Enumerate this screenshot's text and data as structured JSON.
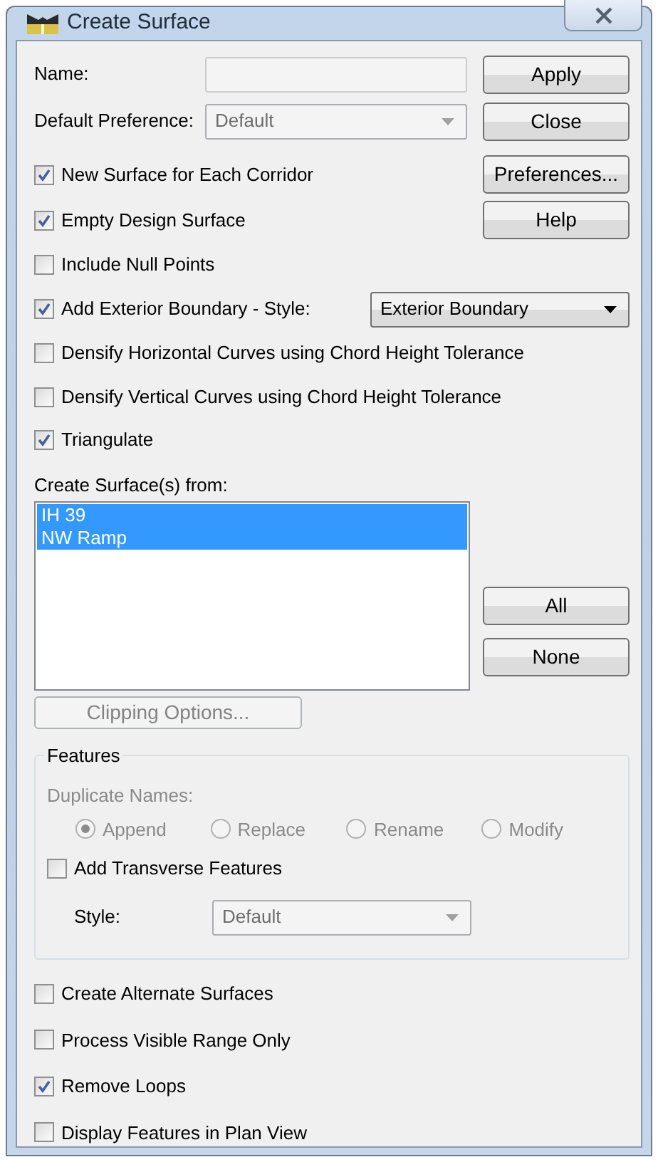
{
  "window": {
    "title": "Create Surface"
  },
  "name_field": {
    "label": "Name:",
    "disabled": true
  },
  "default_preference": {
    "label": "Default Preference:",
    "value": "Default",
    "disabled": true
  },
  "buttons": [
    "Apply",
    "Close",
    "Preferences...",
    "Help"
  ],
  "options": [
    {
      "kind": "checkbox",
      "label": "New Surface for Each Corridor",
      "checked": true
    },
    {
      "kind": "checkbox",
      "label": "Empty Design Surface",
      "checked": true
    },
    {
      "kind": "checkbox",
      "label": "Include Null Points",
      "checked": false
    },
    {
      "kind": "checkbox_select",
      "label": "Add Exterior Boundary - Style:",
      "checked": true,
      "select_value": "Exterior Boundary"
    },
    {
      "kind": "checkbox",
      "label": "Densify Horizontal Curves using Chord Height Tolerance",
      "checked": false
    },
    {
      "kind": "checkbox",
      "label": "Densify Vertical Curves using Chord Height Tolerance",
      "checked": false
    },
    {
      "kind": "checkbox",
      "label": "Triangulate",
      "checked": true
    }
  ],
  "source": {
    "label": "Create Surface(s) from:",
    "items": [
      {
        "label": "IH 39",
        "selected": true
      },
      {
        "label": "NW Ramp",
        "selected": true
      }
    ]
  },
  "list_buttons": [
    "All",
    "None"
  ],
  "clipping_button": {
    "label": "Clipping Options...",
    "disabled": true
  },
  "features": {
    "title": "Features",
    "duplicate_label": "Duplicate Names:",
    "disabled": true,
    "duplicate_options": [
      {
        "label": "Append",
        "selected": true
      },
      {
        "label": "Replace",
        "selected": false
      },
      {
        "label": "Rename",
        "selected": false
      },
      {
        "label": "Modify",
        "selected": false
      }
    ],
    "transverse": {
      "label": "Add Transverse Features",
      "checked": false
    },
    "style": {
      "label": "Style:",
      "value": "Default",
      "disabled": true
    }
  },
  "bottom_options": [
    {
      "label": "Create Alternate Surfaces",
      "checked": false
    },
    {
      "label": "Process Visible Range Only",
      "checked": false
    },
    {
      "label": "Remove Loops",
      "checked": true
    },
    {
      "label": "Display Features in Plan View",
      "checked": false
    }
  ]
}
